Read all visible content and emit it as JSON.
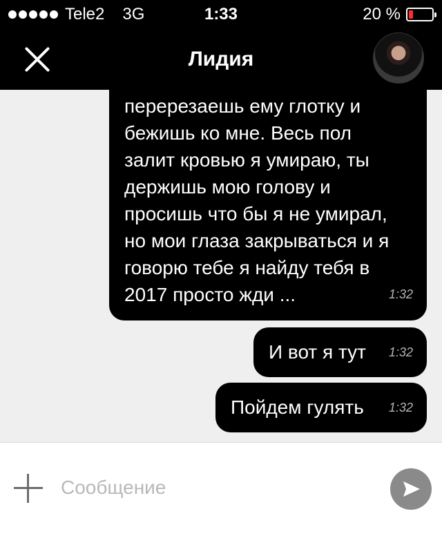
{
  "status_bar": {
    "carrier": "Tele2",
    "network": "3G",
    "time": "1:33",
    "battery": "20 %",
    "battery_level": 0.2,
    "battery_color": "#ff2d2d"
  },
  "header": {
    "title": "Лидия",
    "close_icon": "close-icon",
    "avatar_icon": "avatar"
  },
  "messages": [
    {
      "lines": [
        "перерезаешь ему глотку и",
        "бежишь ко мне. Весь пол",
        "залит кровью я умираю, ты",
        "держишь мою голову и",
        "просишь что бы я не умирал,",
        "но мои глаза закрываться и я",
        "говорю тебе я найду тебя в",
        "2017 просто жди ..."
      ],
      "time": "1:32"
    },
    {
      "text": "И вот я тут",
      "time": "1:32"
    },
    {
      "text": "Пойдем гулять",
      "time": "1:32"
    }
  ],
  "input_bar": {
    "placeholder": "Сообщение",
    "plus_icon": "plus-icon",
    "send_icon": "send-icon"
  },
  "colors": {
    "bubble": "#000000",
    "chat_background": "#efefef",
    "send_button": "#8a8a8a"
  }
}
